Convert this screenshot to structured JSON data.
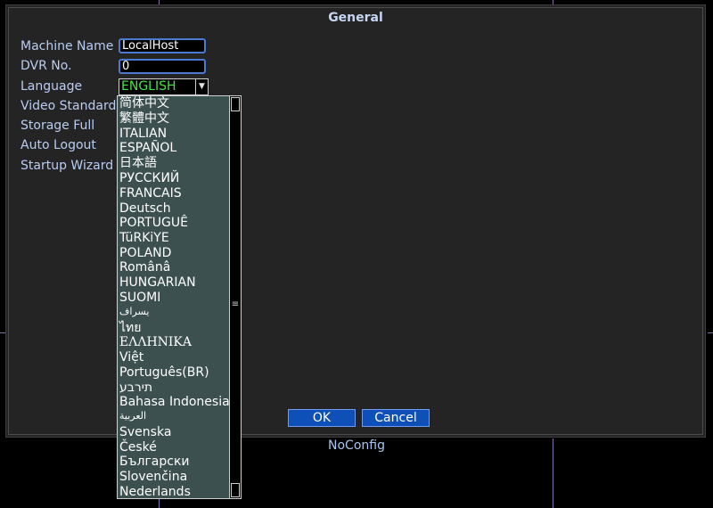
{
  "dialog": {
    "title": "General",
    "labels": {
      "machine_name": "Machine Name",
      "dvr_no": "DVR No.",
      "language": "Language",
      "video_standard": "Video Standard",
      "storage_full": "Storage Full",
      "auto_logout": "Auto Logout",
      "startup_wizard": "Startup Wizard"
    },
    "fields": {
      "machine_name": "LocalHost",
      "dvr_no": "0",
      "language": "ENGLISH"
    },
    "buttons": {
      "ok": "OK",
      "cancel": "Cancel"
    }
  },
  "language_options": [
    "简体中文",
    "繁體中文",
    "ITALIAN",
    "ESPAÑOL",
    "日本語",
    "РУССКИЙ",
    "FRANCAIS",
    "Deutsch",
    "PORTUGUÊ",
    "TüRKiYE",
    "POLAND",
    "Românâ",
    "HUNGARIAN",
    "SUOMI",
    "یسراف",
    "ไทย",
    "ΕΛΛΗΝΙΚΑ",
    "Việt",
    "Português(BR)",
    "תירבע",
    "Bahasa Indonesia",
    "العربية",
    "Svenska",
    "České",
    "Български",
    "Slovenčina",
    "Nederlands"
  ],
  "status": "NoConfig",
  "colors": {
    "accent": "#4a7bd0",
    "selected_text": "#42e642",
    "dropdown_bg": "#3d5050",
    "button_bg": "#0e50b8"
  }
}
